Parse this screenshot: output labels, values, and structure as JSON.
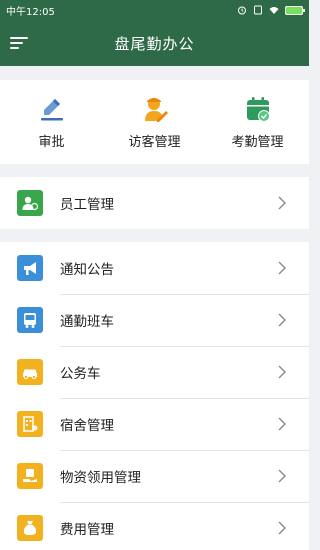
{
  "status": {
    "time": "中午12:05"
  },
  "appbar": {
    "title": "盘尾勤办公"
  },
  "quick": [
    {
      "label": "审批",
      "icon": "pen-edit-icon",
      "color": "#4a7fc1"
    },
    {
      "label": "访客管理",
      "icon": "visitor-icon",
      "color": "#f0a020"
    },
    {
      "label": "考勤管理",
      "icon": "calendar-check-icon",
      "color": "#2e9a5e"
    }
  ],
  "group1": [
    {
      "label": "员工管理",
      "icon": "employee-icon",
      "color": "#3aa64c"
    }
  ],
  "group2": [
    {
      "label": "通知公告",
      "icon": "megaphone-icon",
      "color": "#3b8fd9"
    },
    {
      "label": "通勤班车",
      "icon": "bus-icon",
      "color": "#3b8fd9"
    },
    {
      "label": "公务车",
      "icon": "car-icon",
      "color": "#f2b21f"
    },
    {
      "label": "宿舍管理",
      "icon": "dormitory-icon",
      "color": "#f2b21f"
    },
    {
      "label": "物资领用管理",
      "icon": "supplies-icon",
      "color": "#f2b21f"
    },
    {
      "label": "费用管理",
      "icon": "money-bag-icon",
      "color": "#f2b21f"
    }
  ]
}
